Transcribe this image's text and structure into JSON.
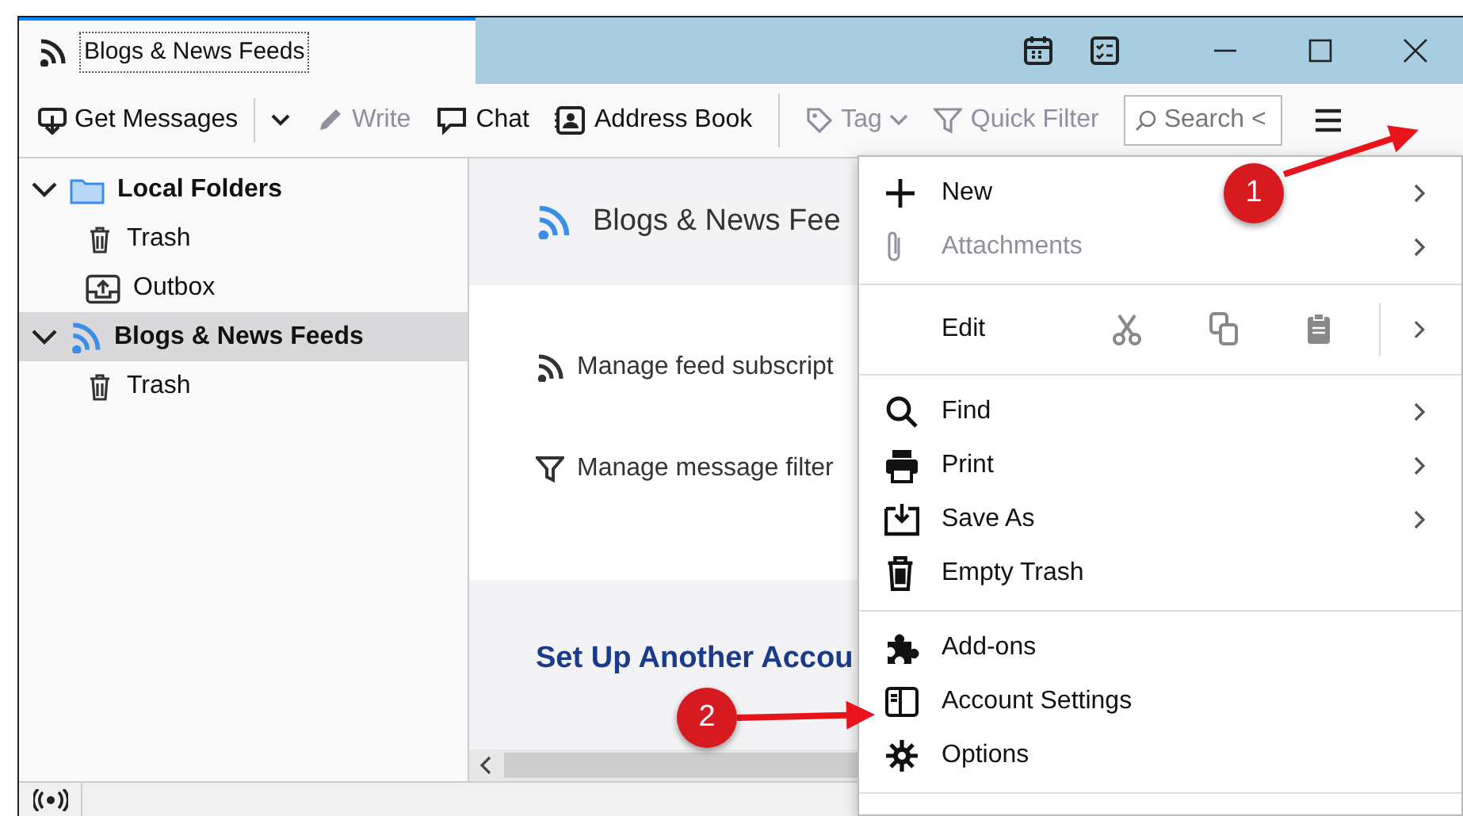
{
  "window": {
    "tab": {
      "title": "Blogs & News Feeds",
      "selected": true
    }
  },
  "toolbar": {
    "items": [
      {
        "kind": "split",
        "label": "Get Messages",
        "disabled": false
      },
      {
        "kind": "button",
        "label": "Write",
        "disabled": true
      },
      {
        "kind": "button",
        "label": "Chat",
        "disabled": false
      },
      {
        "kind": "button",
        "label": "Address Book",
        "disabled": false
      },
      {
        "kind": "separator"
      },
      {
        "kind": "dropdown",
        "label": "Tag",
        "disabled": true
      },
      {
        "kind": "button",
        "label": "Quick Filter",
        "disabled": true
      }
    ],
    "search": {
      "placeholder": "Search <"
    }
  },
  "folders": [
    {
      "label": "Local Folders",
      "kind": "folder",
      "expanded": true,
      "selected": false,
      "children": [
        {
          "label": "Trash",
          "kind": "trash",
          "selected": false
        },
        {
          "label": "Outbox",
          "kind": "outbox",
          "selected": false
        }
      ]
    },
    {
      "label": "Blogs & News Feeds",
      "kind": "feed",
      "expanded": true,
      "selected": true,
      "children": [
        {
          "label": "Trash",
          "kind": "trash",
          "selected": false
        }
      ]
    }
  ],
  "content": {
    "title": "Blogs & News Fee",
    "links": [
      {
        "kind": "feed",
        "label": "Manage feed subscript"
      },
      {
        "kind": "filter",
        "label": "Manage message filter"
      }
    ],
    "section_title": "Set Up Another Accou"
  },
  "menu": {
    "sections": [
      [
        {
          "kind": "new",
          "label": "New",
          "disabled": false,
          "submenu": true
        },
        {
          "kind": "attach",
          "label": "Attachments",
          "disabled": true,
          "submenu": true
        }
      ],
      [
        {
          "kind": "edit",
          "label": "Edit",
          "disabled": false,
          "submenu": true
        }
      ],
      [
        {
          "kind": "find",
          "label": "Find",
          "disabled": false,
          "submenu": true
        },
        {
          "kind": "print",
          "label": "Print",
          "disabled": false,
          "submenu": true
        },
        {
          "kind": "saveas",
          "label": "Save As",
          "disabled": false,
          "submenu": true
        },
        {
          "kind": "trash",
          "label": "Empty Trash",
          "disabled": false,
          "submenu": false
        }
      ],
      [
        {
          "kind": "addons",
          "label": "Add-ons",
          "disabled": false,
          "submenu": false
        },
        {
          "kind": "account",
          "label": "Account Settings",
          "disabled": false,
          "submenu": false
        },
        {
          "kind": "options",
          "label": "Options",
          "disabled": false,
          "submenu": false
        }
      ]
    ]
  },
  "annotations": [
    {
      "label": "1"
    },
    {
      "label": "2"
    }
  ]
}
